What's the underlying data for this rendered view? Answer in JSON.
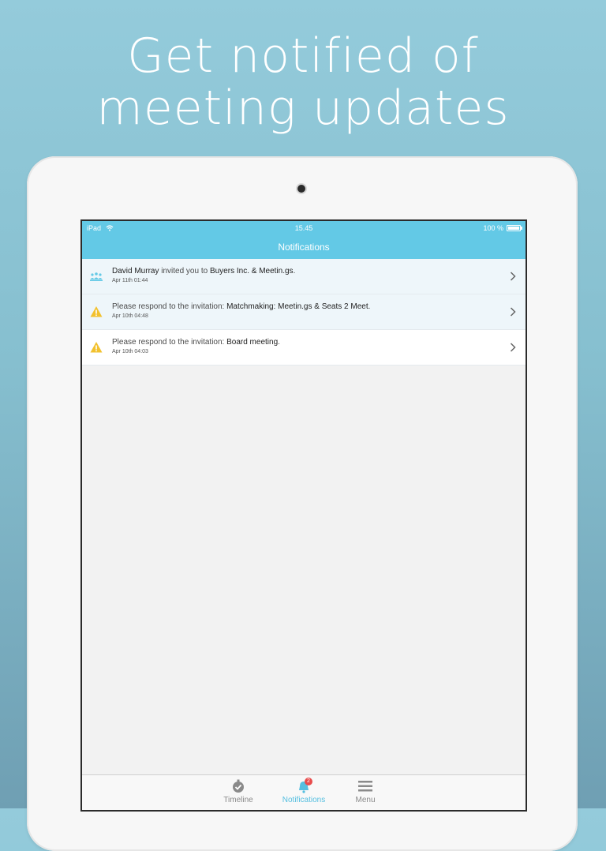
{
  "promo": {
    "headline_line1": "Get notified of",
    "headline_line2": "meeting updates"
  },
  "status_bar": {
    "device": "iPad",
    "time": "15.45",
    "battery": "100 %",
    "battery_level": 1.0
  },
  "nav": {
    "title": "Notifications"
  },
  "notifications": [
    {
      "icon": "group-icon",
      "name": "David Murray",
      "text": " invited you to ",
      "meeting": "Buyers Inc. & Meetin.gs",
      "end": ".",
      "date": "Apr 11th 01:44",
      "unread": true
    },
    {
      "icon": "warning-icon",
      "name": "",
      "text": "Please respond to the invitation: ",
      "meeting": "Matchmaking: Meetin.gs & Seats 2 Meet",
      "end": ".",
      "date": "Apr 10th 04:48",
      "unread": true
    },
    {
      "icon": "warning-icon",
      "name": "",
      "text": "Please respond to the invitation: ",
      "meeting": "Board meeting",
      "end": ".",
      "date": "Apr 10th 04:03",
      "unread": false
    }
  ],
  "tabs": [
    {
      "label": "Timeline",
      "icon": "timeline-icon",
      "active": false
    },
    {
      "label": "Notifications",
      "icon": "bell-icon",
      "active": true,
      "badge": "2"
    },
    {
      "label": "Menu",
      "icon": "menu-icon",
      "active": false
    }
  ],
  "colors": {
    "accent": "#63c9e6",
    "warning": "#f2c12e",
    "badge": "#e84c4c"
  }
}
